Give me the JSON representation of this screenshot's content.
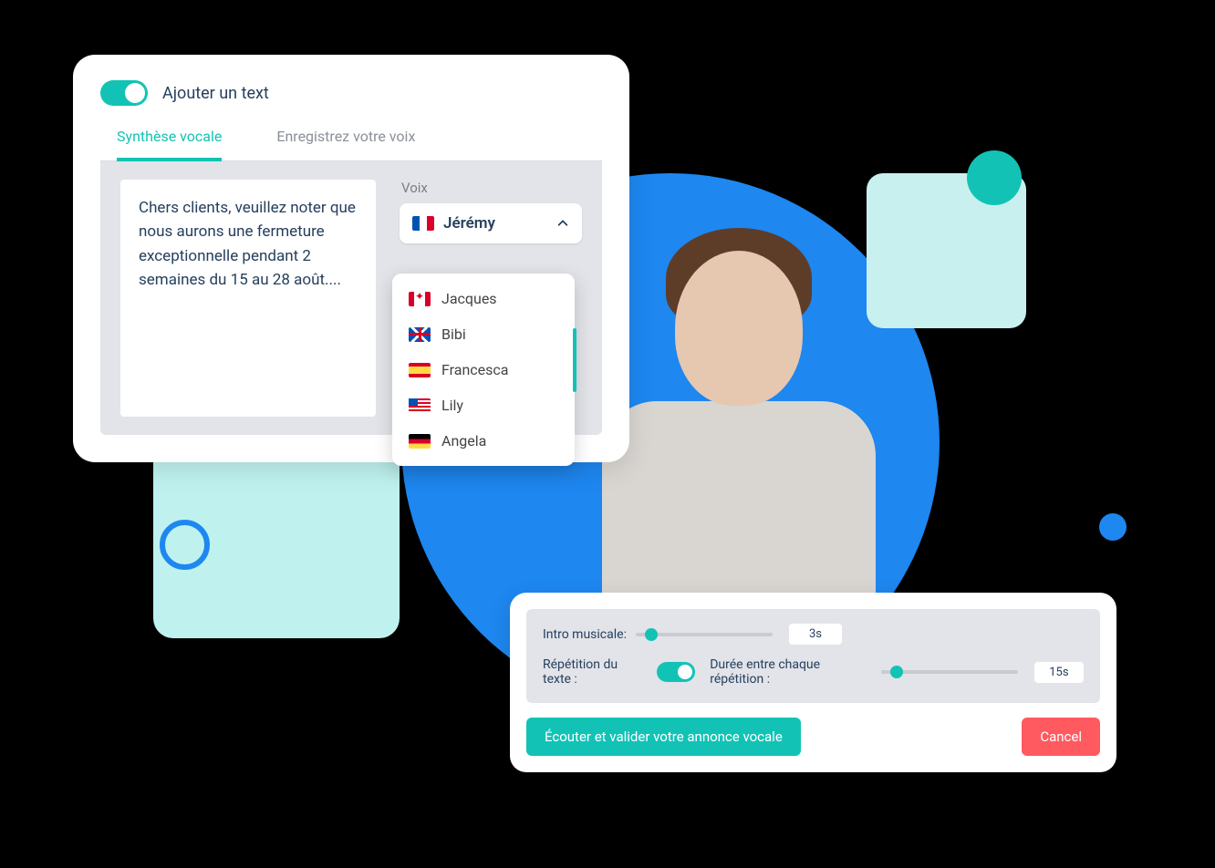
{
  "card1": {
    "toggle_label": "Ajouter un text",
    "tabs": [
      {
        "label": "Synthèse vocale",
        "active": true
      },
      {
        "label": "Enregistrez votre voix",
        "active": false
      }
    ],
    "text": "Chers clients, veuillez noter que nous aurons une fermeture exceptionnelle pendant 2 semaines du 15 au 28 août....",
    "voice_label": "Voix",
    "voice_selected": {
      "name": "Jérémy",
      "flag": "fr"
    },
    "voice_options": [
      {
        "name": "Jacques",
        "flag": "ca"
      },
      {
        "name": "Bibi",
        "flag": "uk"
      },
      {
        "name": "Francesca",
        "flag": "es"
      },
      {
        "name": "Lily",
        "flag": "us"
      },
      {
        "name": "Angela",
        "flag": "de"
      }
    ]
  },
  "card2": {
    "intro_label": "Intro musicale:",
    "intro_value": "3s",
    "repeat_label": "Répétition du texte :",
    "gap_label": "Durée entre chaque répétition :",
    "gap_value": "15s",
    "primary_btn": "Écouter et valider votre annonce vocale",
    "cancel_btn": "Cancel"
  }
}
